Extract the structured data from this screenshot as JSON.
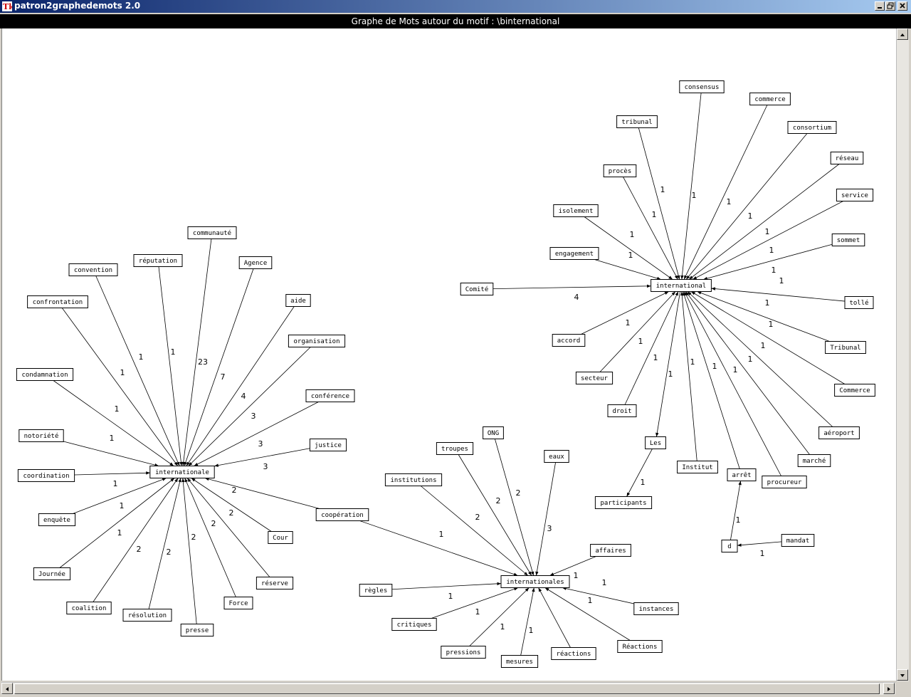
{
  "window": {
    "title": "patron2graphedemots 2.0"
  },
  "canvas_header": "Graphe de Mots autour du motif : \\binternational",
  "hubs": {
    "internationale": "internationale",
    "international": "international",
    "internationales": "internationales",
    "d": "d"
  },
  "groups": [
    {
      "hub": "internationale",
      "nodes": [
        {
          "label": "communauté",
          "w": "23"
        },
        {
          "label": "réputation",
          "w": "1"
        },
        {
          "label": "convention",
          "w": "1"
        },
        {
          "label": "confrontation",
          "w": "1"
        },
        {
          "label": "condamnation",
          "w": "1"
        },
        {
          "label": "notoriété",
          "w": "1"
        },
        {
          "label": "coordination",
          "w": ""
        },
        {
          "label": "Agence",
          "w": "7"
        },
        {
          "label": "aide",
          "w": "4"
        },
        {
          "label": "organisation",
          "w": "3"
        },
        {
          "label": "conférence",
          "w": "3"
        },
        {
          "label": "justice",
          "w": "3"
        },
        {
          "label": "enquête",
          "w": "1"
        },
        {
          "label": "Journée",
          "w": "1"
        },
        {
          "label": "coalition",
          "w": "1"
        },
        {
          "label": "résolution",
          "w": "2"
        },
        {
          "label": "presse",
          "w": "2"
        },
        {
          "label": "Force",
          "w": "2"
        },
        {
          "label": "réserve",
          "w": "2"
        },
        {
          "label": "Cour",
          "w": "2"
        },
        {
          "label": "coopération",
          "w": "2"
        }
      ]
    },
    {
      "hub": "international",
      "nodes": [
        {
          "label": "consensus",
          "w": "1"
        },
        {
          "label": "tribunal",
          "w": "1"
        },
        {
          "label": "commerce",
          "w": "1"
        },
        {
          "label": "consortium",
          "w": "1"
        },
        {
          "label": "réseau",
          "w": "1"
        },
        {
          "label": "procès",
          "w": "1"
        },
        {
          "label": "isolement",
          "w": "1"
        },
        {
          "label": "service",
          "w": "1"
        },
        {
          "label": "sommet",
          "w": "1"
        },
        {
          "label": "engagement",
          "w": "1"
        },
        {
          "label": "Comité",
          "w": "4"
        },
        {
          "label": "tollé",
          "w": "1"
        },
        {
          "label": "Tribunal",
          "w": "1"
        },
        {
          "label": "accord",
          "w": "1"
        },
        {
          "label": "Commerce",
          "w": "1"
        },
        {
          "label": "secteur",
          "w": "1"
        },
        {
          "label": "droit",
          "w": "1"
        },
        {
          "label": "aéroport",
          "w": "1"
        },
        {
          "label": "marché",
          "w": "1"
        },
        {
          "label": "Institut",
          "w": "1"
        },
        {
          "label": "procureur",
          "w": "1"
        },
        {
          "label": "arrêt",
          "w": "1"
        }
      ],
      "out_nodes": [
        {
          "label": "Les",
          "w": "1"
        }
      ]
    },
    {
      "hub": "internationales",
      "nodes": [
        {
          "label": "ONG",
          "w": "2"
        },
        {
          "label": "troupes",
          "w": "2"
        },
        {
          "label": "eaux",
          "w": "3"
        },
        {
          "label": "institutions",
          "w": "2"
        },
        {
          "label": "affaires",
          "w": "1"
        },
        {
          "label": "règles",
          "w": ""
        },
        {
          "label": "instances",
          "w": "1"
        },
        {
          "label": "critiques",
          "w": "1"
        },
        {
          "label": "Réactions",
          "w": "1"
        },
        {
          "label": "pressions",
          "w": "1"
        },
        {
          "label": "mesures",
          "w": "1"
        },
        {
          "label": "réactions",
          "w": "1"
        }
      ]
    }
  ],
  "extra": [
    {
      "from": "coopération",
      "to": "internationales",
      "w": "1"
    },
    {
      "from": "Les",
      "to": "participants",
      "w": "1"
    },
    {
      "from": "d",
      "to": "arrêt",
      "w": "1"
    },
    {
      "from": "mandat",
      "to": "d",
      "w": "1"
    }
  ],
  "extra_labels": {
    "participants": "participants",
    "mandat": "mandat"
  },
  "colors": {
    "titlebar_start": "#0a246a",
    "titlebar_end": "#a6caf0",
    "canvas_bg": "#ffffff",
    "edge": "#000000"
  }
}
